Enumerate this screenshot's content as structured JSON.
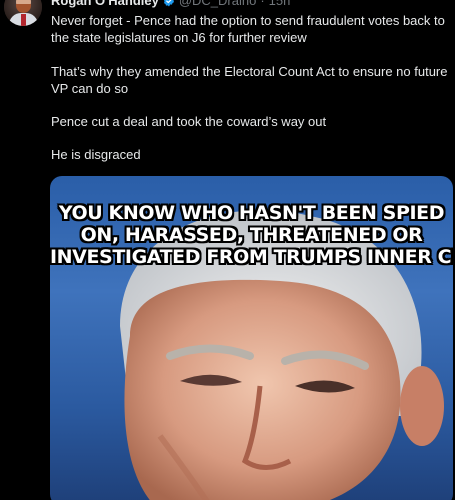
{
  "tweet": {
    "author": {
      "display_name": "Rogan O'Handley",
      "handle": "@DC_Draino",
      "separator": "·",
      "time": "15h",
      "verified": true,
      "verified_color": "#1d9bf0"
    },
    "paragraphs": [
      "Never forget - Pence had the option to send fraudulent votes back to the state legislatures on J6 for further review",
      "That’s why they amended the Electoral Count Act to ensure no future VP can do so",
      "Pence cut a deal and took the coward’s way out",
      "He is disgraced"
    ],
    "media": {
      "caption_lines": [
        "YOU KNOW WHO HASN'T BEEN SPIED",
        "ON, HARASSED, THREATENED OR",
        "INVESTIGATED FROM TRUMPS INNER CIRCLE?!"
      ],
      "background_color": "#3a6db5"
    }
  },
  "colors": {
    "background": "#000000",
    "text_primary": "#e7e9ea",
    "text_secondary": "#71767b"
  }
}
